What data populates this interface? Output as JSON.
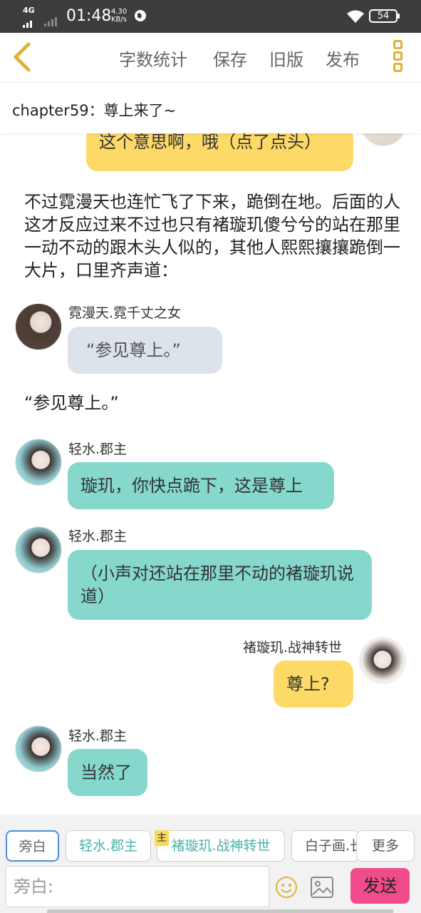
{
  "status": {
    "network": "4G",
    "time": "01:48",
    "speed_value": "4.30",
    "speed_unit": "KB/s",
    "battery": "54"
  },
  "toolbar": {
    "word_count_label": "字数统计",
    "save_label": "保存",
    "old_version_label": "旧版",
    "publish_label": "发布"
  },
  "chapter": {
    "title": "chapter59：尊上来了~"
  },
  "messages": [
    {
      "type": "bubble",
      "side": "right",
      "text": "这个意思啊，哦（点了点头）"
    },
    {
      "type": "narration",
      "text": "不过霓漫天也连忙飞了下来，跪倒在地。后面的人这才反应过来不过也只有褚璇玑傻兮兮的站在那里一动不动的跟木头人似的，其他人熙熙攘攘跪倒一大片，口里齐声道："
    },
    {
      "type": "bubble",
      "side": "left",
      "speaker": "霓漫天.霓千丈之女",
      "text": "“参见尊上。”"
    },
    {
      "type": "narration",
      "text": "“参见尊上。”"
    },
    {
      "type": "bubble",
      "side": "left",
      "speaker": "轻水.郡主",
      "text": "璇玑，你快点跪下，这是尊上"
    },
    {
      "type": "bubble",
      "side": "left",
      "speaker": "轻水.郡主",
      "text": "（小声对还站在那里不动的褚璇玑说道）"
    },
    {
      "type": "bubble",
      "side": "right",
      "speaker": "褚璇玑.战神转世",
      "text": "尊上?"
    },
    {
      "type": "bubble",
      "side": "left",
      "speaker": "轻水.郡主",
      "text": "当然了"
    }
  ],
  "characters": {
    "tag_main": "主",
    "chips": [
      "旁白",
      "轻水.郡主",
      "褚璇玑.战神转世",
      "白子画.长"
    ],
    "more_label": "更多"
  },
  "composer": {
    "placeholder": "旁白:",
    "send_label": "发送"
  },
  "colors": {
    "yellow_bubble": "#fdd967",
    "teal_bubble": "#86d8cd",
    "grey_bubble": "#dde3ea",
    "send_button": "#f04c8c",
    "accent": "#e0b23a"
  }
}
